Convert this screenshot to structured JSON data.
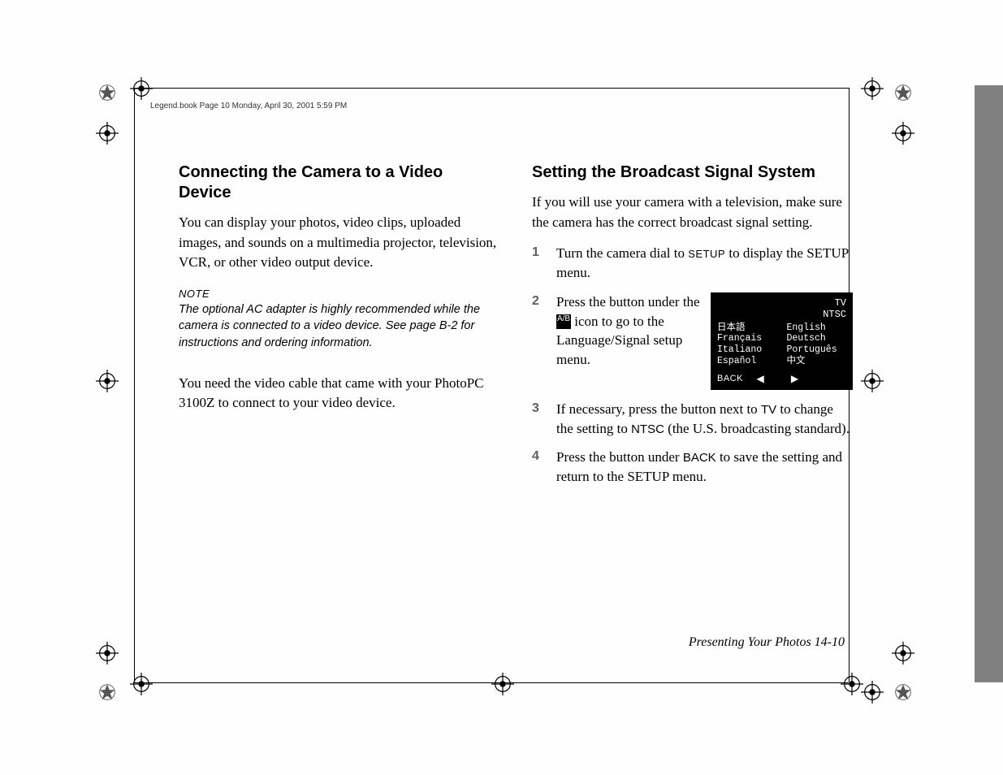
{
  "header": "Legend.book  Page 10  Monday, April 30, 2001  5:59 PM",
  "left": {
    "h": "Connecting the Camera to a Video Device",
    "p1": "You can display your photos, video clips, uploaded images, and sounds on a multimedia projector, television, VCR, or other video output device.",
    "note_h": "NOTE",
    "note": "The optional AC adapter is highly recommended while the camera is connected to a video device. See page B-2 for instructions and ordering information.",
    "p2": "You need the video cable that came with your PhotoPC 3100Z to connect to your video device."
  },
  "right": {
    "h": "Setting the Broadcast Signal System",
    "intro": "If you will use your camera with a television, make sure the camera has the correct broadcast signal setting.",
    "step1a": "Turn the camera dial to ",
    "step1_setup": "SETUP",
    "step1b": " to display the SETUP menu.",
    "step2a": "Press the button under the ",
    "step2_icon": "A/B",
    "step2b": " icon to go to the Language/Signal setup menu.",
    "step3a": "If necessary, press the button next to ",
    "step3_tv": "TV",
    "step3b": " to change the setting to ",
    "step3_ntsc": "NTSC",
    "step3c": " (the U.S. broadcasting standard).",
    "step4a": "Press the button under ",
    "step4_back": "BACK",
    "step4b": " to save the setting and return to the SETUP menu."
  },
  "lcd": {
    "tv": "TV",
    "ntsc": "NTSC",
    "col1": [
      "日本語",
      "Français",
      "Italiano",
      "Español"
    ],
    "col2": [
      "English",
      "Deutsch",
      "Português",
      "中文"
    ],
    "back": "BACK",
    "left_arrow": "◀",
    "right_arrow": "▶"
  },
  "footer": "Presenting Your Photos  14-10"
}
